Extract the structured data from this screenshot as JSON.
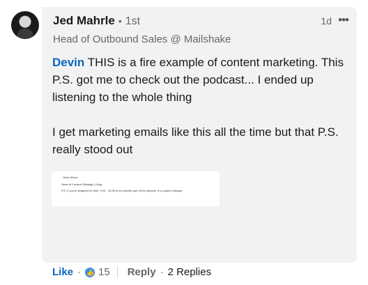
{
  "author": {
    "name": "Jed Mahrle",
    "degree": "1st",
    "headline": "Head of Outbound Sales @ Mailshake"
  },
  "comment": {
    "time": "1d",
    "more_icon": "ellipsis-icon",
    "mention": "Devin",
    "paragraph1": " THIS is a fire example of content marketing. This P.S. got me to check out the podcast... I ended up listening to the whole thing",
    "paragraph2": "I get marketing emails like this all the time but that P.S. really stood out"
  },
  "preview": {
    "line1": "- Devin Reed",
    "line2": "Head of Content Strategy | Gong",
    "line3": "P.S. If you're strapped for time, 9:29 - 10:35 is my favorite part of the episode. It's a game-changer."
  },
  "actions": {
    "like": "Like",
    "reaction_icon": "thumbs-up-icon",
    "reaction_count": "15",
    "reply": "Reply",
    "replies": "2 Replies"
  }
}
